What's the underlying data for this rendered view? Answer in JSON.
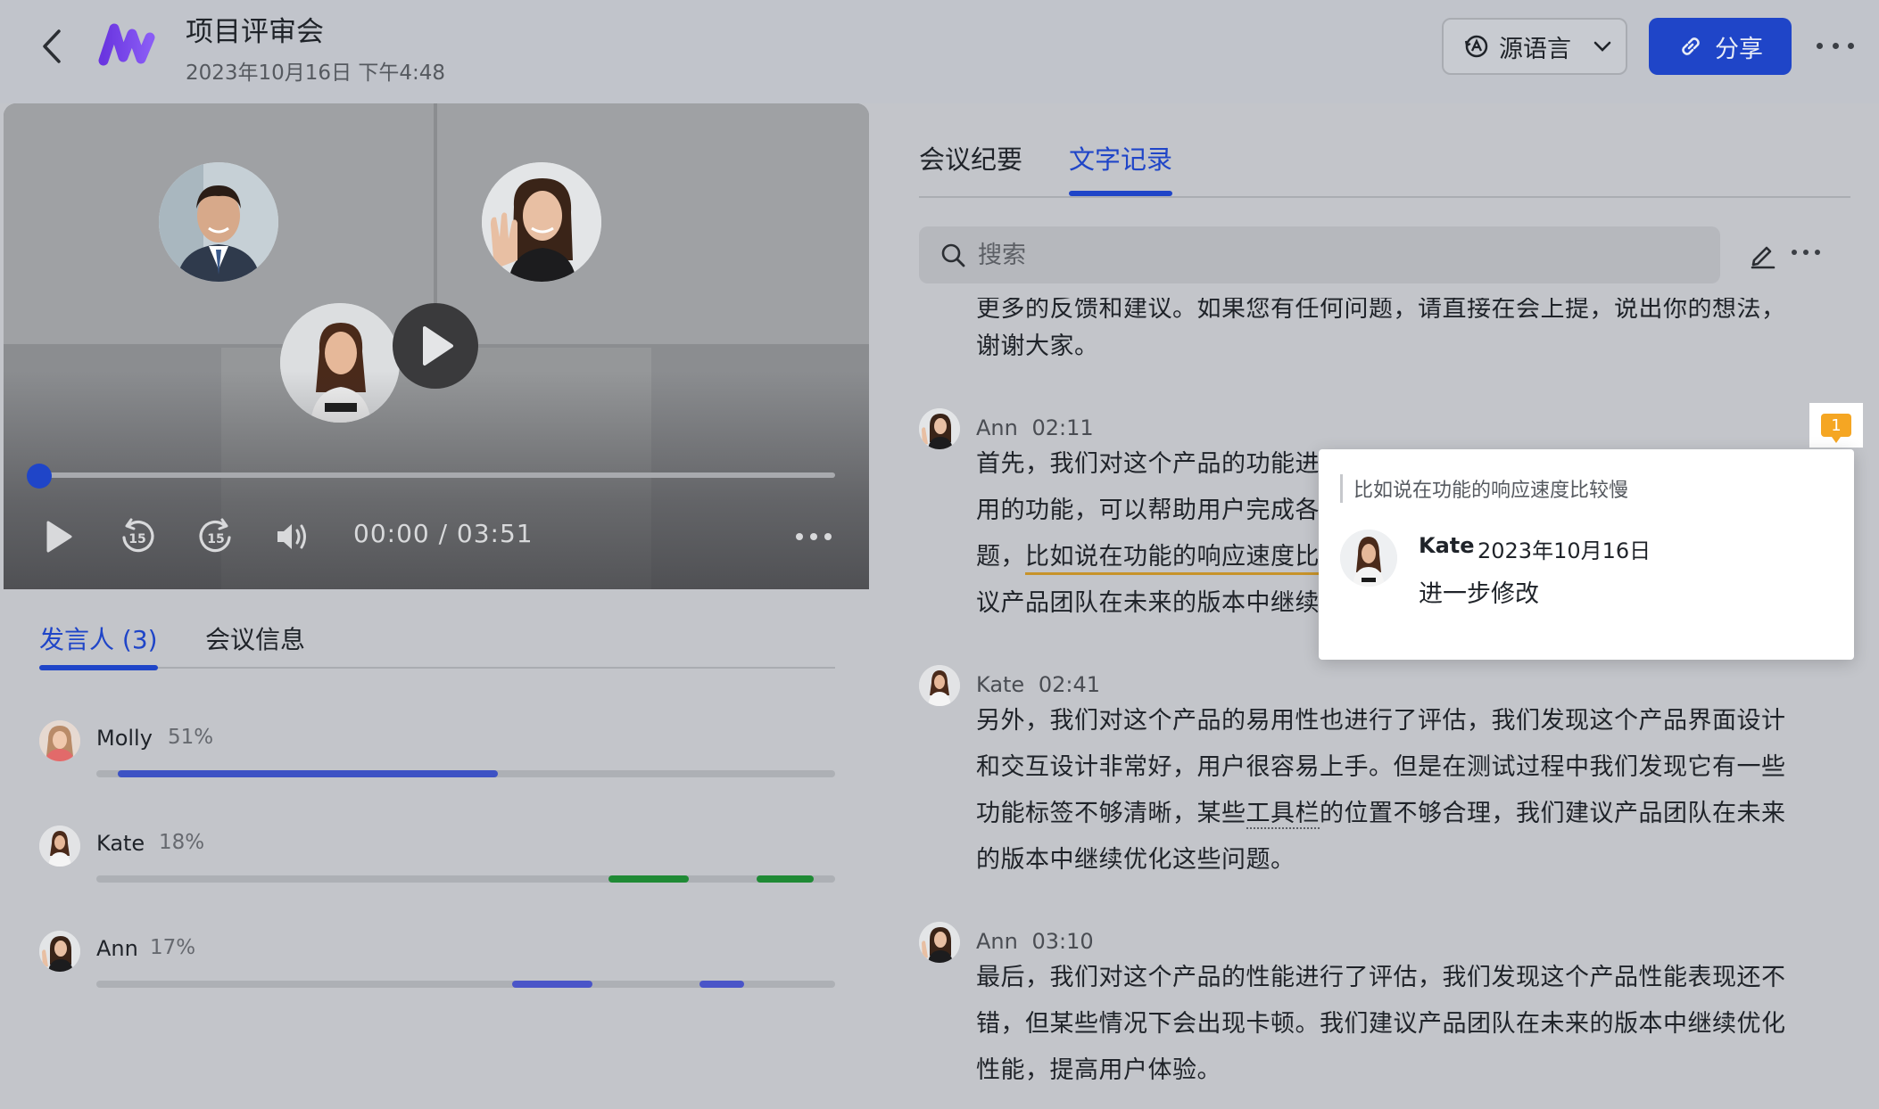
{
  "header": {
    "title": "项目评审会",
    "datetime": "2023年10月16日 下午4:48",
    "language_button": "源语言",
    "share_button": "分享"
  },
  "player": {
    "time": "00:00 / 03:51",
    "progress": 0,
    "skip_back_label": "15",
    "skip_forward_label": "15"
  },
  "left_tabs": [
    {
      "label": "发言人 (3)",
      "active": true
    },
    {
      "label": "会议信息",
      "active": false
    }
  ],
  "speakers": [
    {
      "name": "Molly",
      "percent": "51%",
      "color": "#3d52c4"
    },
    {
      "name": "Kate",
      "percent": "18%",
      "color": "#1f8a35"
    },
    {
      "name": "Ann",
      "percent": "17%",
      "color": "#4a55c8"
    }
  ],
  "right_tabs": [
    {
      "label": "会议纪要",
      "active": false
    },
    {
      "label": "文字记录",
      "active": true
    }
  ],
  "search": {
    "placeholder": "搜索"
  },
  "transcript": {
    "partial_line_1": "更多的反馈和建议。如果您有任何问题，请直接在会上提，说出你的想法，",
    "partial_line_2": "谢谢大家。",
    "entries": [
      {
        "speaker": "Ann",
        "time": "02:11",
        "lines": [
          "首先，我们对这个产品的功能进",
          "用的功能，可以帮助用户完成各",
          "题，",
          "议产品团队在未来的版本中继续"
        ],
        "highlight": "比如说在功能的响应速度比"
      },
      {
        "speaker": "Kate",
        "time": "02:41",
        "lines": [
          "另外，我们对这个产品的易用性也进行了评估，我们发现这个产品界面设计",
          "和交互设计非常好，用户很容易上手。但是在测试过程中我们发现它有一些",
          "功能标签不够清晰，某些",
          "的位置不够合理，我们建议产品团队在未来",
          "的版本中继续优化这些问题。"
        ],
        "dotted": "工具栏"
      },
      {
        "speaker": "Ann",
        "time": "03:10",
        "lines": [
          "最后，我们对这个产品的性能进行了评估，我们发现这个产品性能表现还不",
          "错，但某些情况下会出现卡顿。我们建议产品团队在未来的版本中继续优化",
          "性能，提高用户体验。"
        ]
      }
    ]
  },
  "comment": {
    "count": "1",
    "quote": "比如说在功能的响应速度比较慢",
    "author": "Kate",
    "date": "2023年10月16日",
    "text": "进一步修改"
  },
  "colors": {
    "accent": "#1f45c8",
    "highlight_underline": "#c7932a",
    "comment_badge": "#f5a623"
  }
}
